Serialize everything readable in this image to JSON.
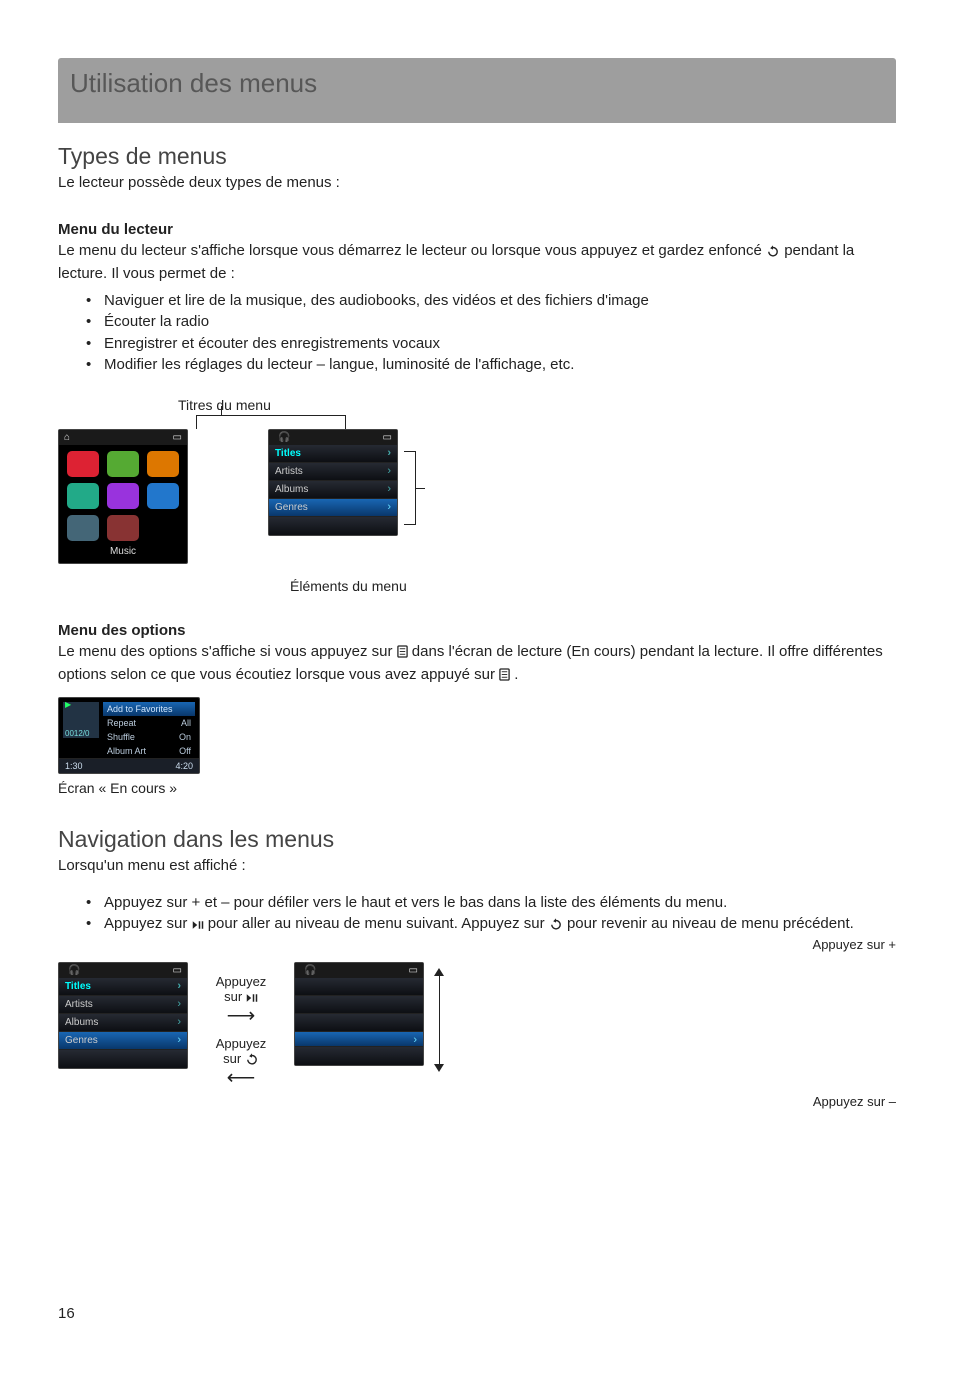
{
  "page_number": "16",
  "title_bar": "Utilisation des menus",
  "section1": {
    "heading": "Types de menus",
    "intro": "Le lecteur possède deux types de menus :",
    "menu_du_lecteur_heading": "Menu du lecteur",
    "menu_du_lecteur_text_a": "Le menu du lecteur s'affiche lorsque vous démarrez le lecteur ou lorsque vous appuyez et gardez enfoncé ",
    "menu_du_lecteur_text_b": " pendant la lecture. Il vous permet de :",
    "bullets": [
      "Naviguer et lire de la musique, des audiobooks, des vidéos et des fichiers d'image",
      "Écouter la radio",
      "Enregistrer et écouter des enregistrements vocaux",
      "Modifier les réglages du lecteur – langue, luminosité de l'affichage, etc."
    ],
    "titres_label": "Titres du menu",
    "elements_label": "Éléments du menu",
    "menu_des_options_heading": "Menu des options",
    "menu_des_options_text_a": "Le menu des options s'affiche si vous appuyez sur ",
    "menu_des_options_text_b": " dans l'écran de lecture (En cours) pendant la lecture. Il offre différentes options selon ce que vous écoutiez lorsque vous avez appuyé sur ",
    "menu_des_options_text_c": " .",
    "np_caption": "Écran « En cours »"
  },
  "player_home": {
    "footer_label": "Music"
  },
  "list_menu": {
    "items": [
      "Titles",
      "Artists",
      "Albums",
      "Genres"
    ]
  },
  "now_playing": {
    "counter": "0012/0",
    "options": [
      {
        "label": "Add to Favorites",
        "value": ""
      },
      {
        "label": "Repeat",
        "value": "All"
      },
      {
        "label": "Shuffle",
        "value": "On"
      },
      {
        "label": "Album Art",
        "value": "Off"
      }
    ],
    "time_left": "1:30",
    "time_right": "4:20"
  },
  "section2": {
    "heading": "Navigation dans les menus",
    "intro": "Lorsqu'un menu est affiché :",
    "bullet1": "Appuyez sur + et – pour défiler vers le haut et vers le bas dans la liste des éléments du menu.",
    "bullet2_a": "Appuyez sur ",
    "bullet2_b": " pour aller au niveau de menu suivant. Appuyez sur ",
    "bullet2_c": " pour revenir au niveau de menu précédent.",
    "appuyez_sur_play_a": "Appuyez",
    "appuyez_sur_play_b": "sur ",
    "appuyez_sur_back_a": "Appuyez",
    "appuyez_sur_back_b": "sur ",
    "appuyez_plus": "Appuyez sur +",
    "appuyez_minus": "Appuyez sur –"
  }
}
